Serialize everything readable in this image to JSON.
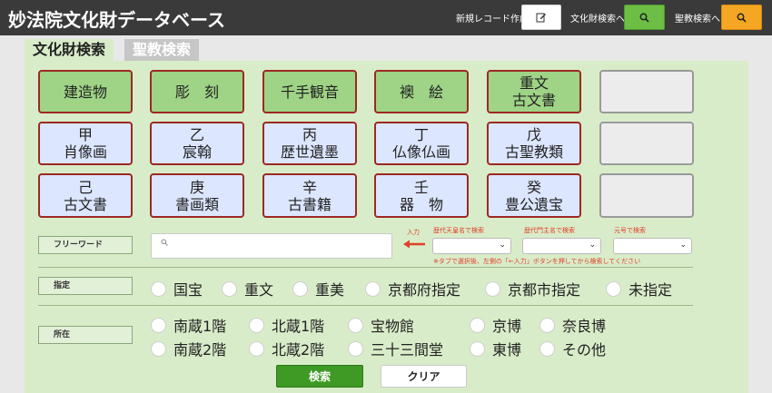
{
  "header": {
    "title": "妙法院文化財データベース",
    "new_record_label": "新規レコード作成",
    "cultural_search_label": "文化財検索へ",
    "scripture_search_label": "聖教検索へ",
    "colors": {
      "bar": "#3a3a3a",
      "green": "#6cbe45",
      "orange": "#f5a623"
    }
  },
  "tabs": [
    {
      "label": "文化財検索",
      "active": true
    },
    {
      "label": "聖教検索",
      "active": false
    }
  ],
  "categories": [
    {
      "line1": "建造物",
      "line2": ""
    },
    {
      "line1": "彫　刻",
      "line2": ""
    },
    {
      "line1": "千手観音",
      "line2": ""
    },
    {
      "line1": "襖　絵",
      "line2": ""
    },
    {
      "line1": "重文",
      "line2": "古文書"
    },
    {
      "line1": "甲",
      "line2": "肖像画"
    },
    {
      "line1": "乙",
      "line2": "宸翰"
    },
    {
      "line1": "丙",
      "line2": "歴世遺墨"
    },
    {
      "line1": "丁",
      "line2": "仏像仏画"
    },
    {
      "line1": "戊",
      "line2": "古聖教類"
    },
    {
      "line1": "己",
      "line2": "古文書"
    },
    {
      "line1": "庚",
      "line2": "書画類"
    },
    {
      "line1": "辛",
      "line2": "古書籍"
    },
    {
      "line1": "壬",
      "line2": "器　物"
    },
    {
      "line1": "癸",
      "line2": "豊公遺宝"
    }
  ],
  "freeword": {
    "label": "フリーワード",
    "input_label": "入力",
    "emperor_label": "歴代天皇名で検索",
    "abbot_label": "歴代門主名で検索",
    "era_label": "元号で検索",
    "note": "※タブで選択後、左側の「←入力」ボタンを押してから検索してください"
  },
  "designation": {
    "label": "指定",
    "options": [
      "国宝",
      "重文",
      "重美",
      "京都府指定",
      "京都市指定",
      "未指定"
    ]
  },
  "location": {
    "label": "所在",
    "options": [
      "南蔵1階",
      "北蔵1階",
      "宝物館",
      "京博",
      "奈良博",
      "南蔵2階",
      "北蔵2階",
      "三十三間堂",
      "東博",
      "その他"
    ]
  },
  "actions": {
    "search_label": "検索",
    "clear_label": "クリア"
  }
}
